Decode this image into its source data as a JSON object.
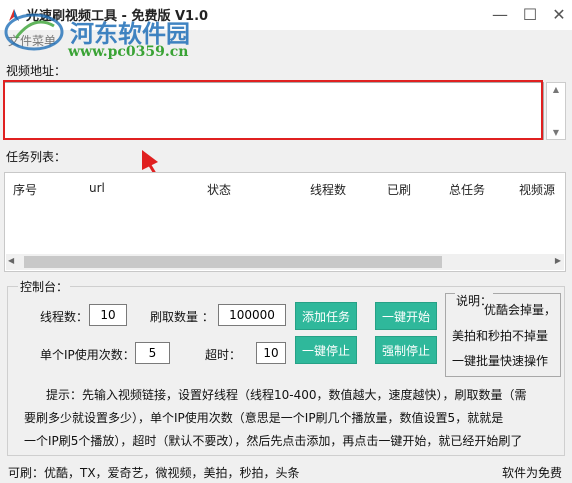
{
  "window": {
    "title": "光速刷视频工具 - 免费版 V1.0",
    "minimize_glyph": "—",
    "maximize_glyph": "☐",
    "close_glyph": "✕"
  },
  "watermark": {
    "site_name": "河东软件园",
    "url": "www.pc0359.cn"
  },
  "menu": {
    "file": "文件菜单"
  },
  "url_section": {
    "label": "视频地址：",
    "value": ""
  },
  "task_list": {
    "label": "任务列表：",
    "columns": [
      "序号",
      "url",
      "状态",
      "线程数",
      "已刷",
      "总任务",
      "视频源"
    ],
    "rows": []
  },
  "console": {
    "label": "控制台：",
    "threads_label": "线程数：",
    "threads_value": "10",
    "count_label": "刷取数量 ：",
    "count_value": "100000",
    "ip_label": "单个IP使用次数：",
    "ip_value": "5",
    "timeout_label": "超时：",
    "timeout_value": "10",
    "add_task_button": "添加任务",
    "start_all_button": "一键开始",
    "stop_all_button": "一键停止",
    "force_stop_button": "强制停止",
    "note": {
      "title": "说明：",
      "line1": "优酷会掉量，",
      "line2": "美拍和秒拍不掉量",
      "line3": "一键批量快速操作"
    },
    "tips": [
      "提示：先输入视频链接，设置好线程（线程10-400，数值越大，速度越快），刷取数量（需",
      "要刷多少就设置多少），单个IP使用次数（意思是一个IP刷几个播放量，数值设置5，就就是",
      "一个IP刷5个播放），超时（默认不要改），然后先点击添加，再点击一键开始，就已经开始刷了"
    ]
  },
  "status": {
    "left": "可刷：优酷，TX，爱奇艺，微视频，美拍，秒拍，头条",
    "right": "软件为免费"
  },
  "colors": {
    "button_green": "#2fb89b",
    "highlight_red": "#e02020",
    "watermark_blue": "#1f6fb8",
    "watermark_green": "#3aa335"
  }
}
